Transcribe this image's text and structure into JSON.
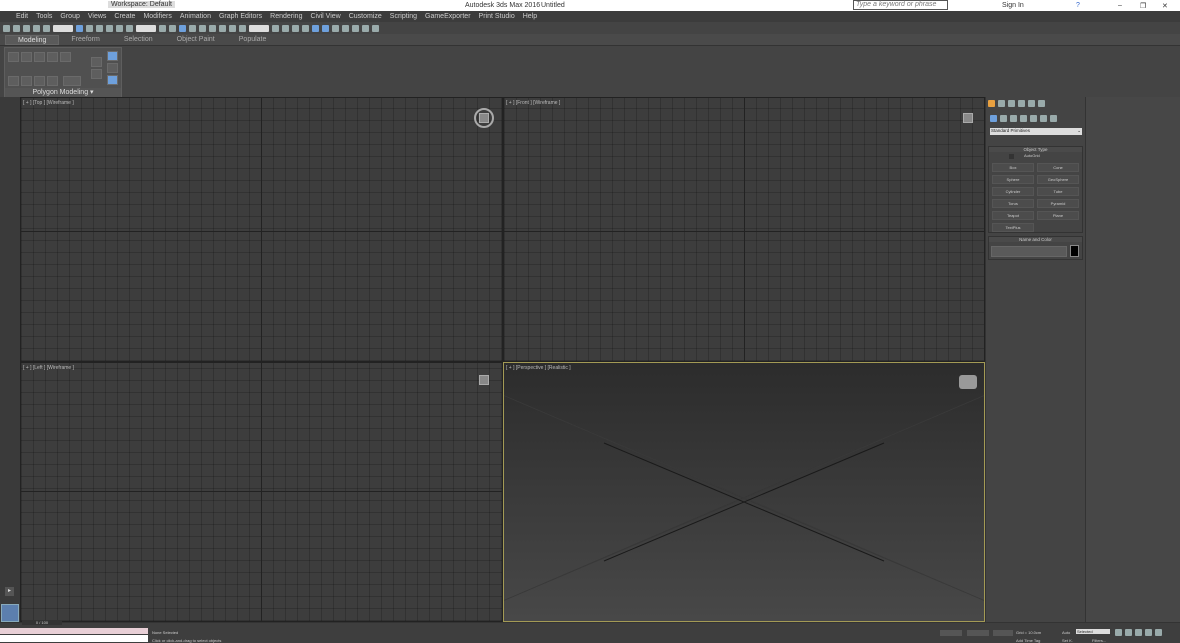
{
  "titlebar": {
    "workspace": "Workspace: Default",
    "app_title": "Autodesk 3ds Max 2016",
    "doc": "Untitled",
    "search_placeholder": "Type a keyword or phrase",
    "sign_in": "Sign In"
  },
  "menu": [
    "Edit",
    "Tools",
    "Group",
    "Views",
    "Create",
    "Modifiers",
    "Animation",
    "Graph Editors",
    "Rendering",
    "Civil View",
    "Customize",
    "Scripting",
    "GameExporter",
    "Print Studio",
    "Help"
  ],
  "ribbon": {
    "tabs": [
      "Modeling",
      "Freeform",
      "Selection",
      "Object Paint",
      "Populate"
    ],
    "panel_label": "Polygon Modeling"
  },
  "viewports": {
    "top": "[ + ] [Top ] [Wireframe ]",
    "front": "[ + ] [Front ] [Wireframe ]",
    "left": "[ + ] [Left ] [Wireframe ]",
    "perspective": "[ + ] [Perspective ] [Realistic ]"
  },
  "command_panel": {
    "dropdown": "Standard Primitives",
    "object_type": "Object Type",
    "autogrid": "AutoGrid",
    "buttons": [
      "Box",
      "Cone",
      "Sphere",
      "GeoSphere",
      "Cylinder",
      "Tube",
      "Torus",
      "Pyramid",
      "Teapot",
      "Plane",
      "TextPlus"
    ],
    "name_color": "Name and Color"
  },
  "timeline": {
    "frame": "0 / 100"
  },
  "status": {
    "selection": "None Selected",
    "prompt": "Click or click-and-drag to select objects",
    "grid": "Grid = 10.0cm",
    "add_time_tag": "Add Time Tag",
    "auto": "Auto",
    "set_key": "Set K.",
    "selected": "Selected",
    "filters": "Filters..."
  }
}
